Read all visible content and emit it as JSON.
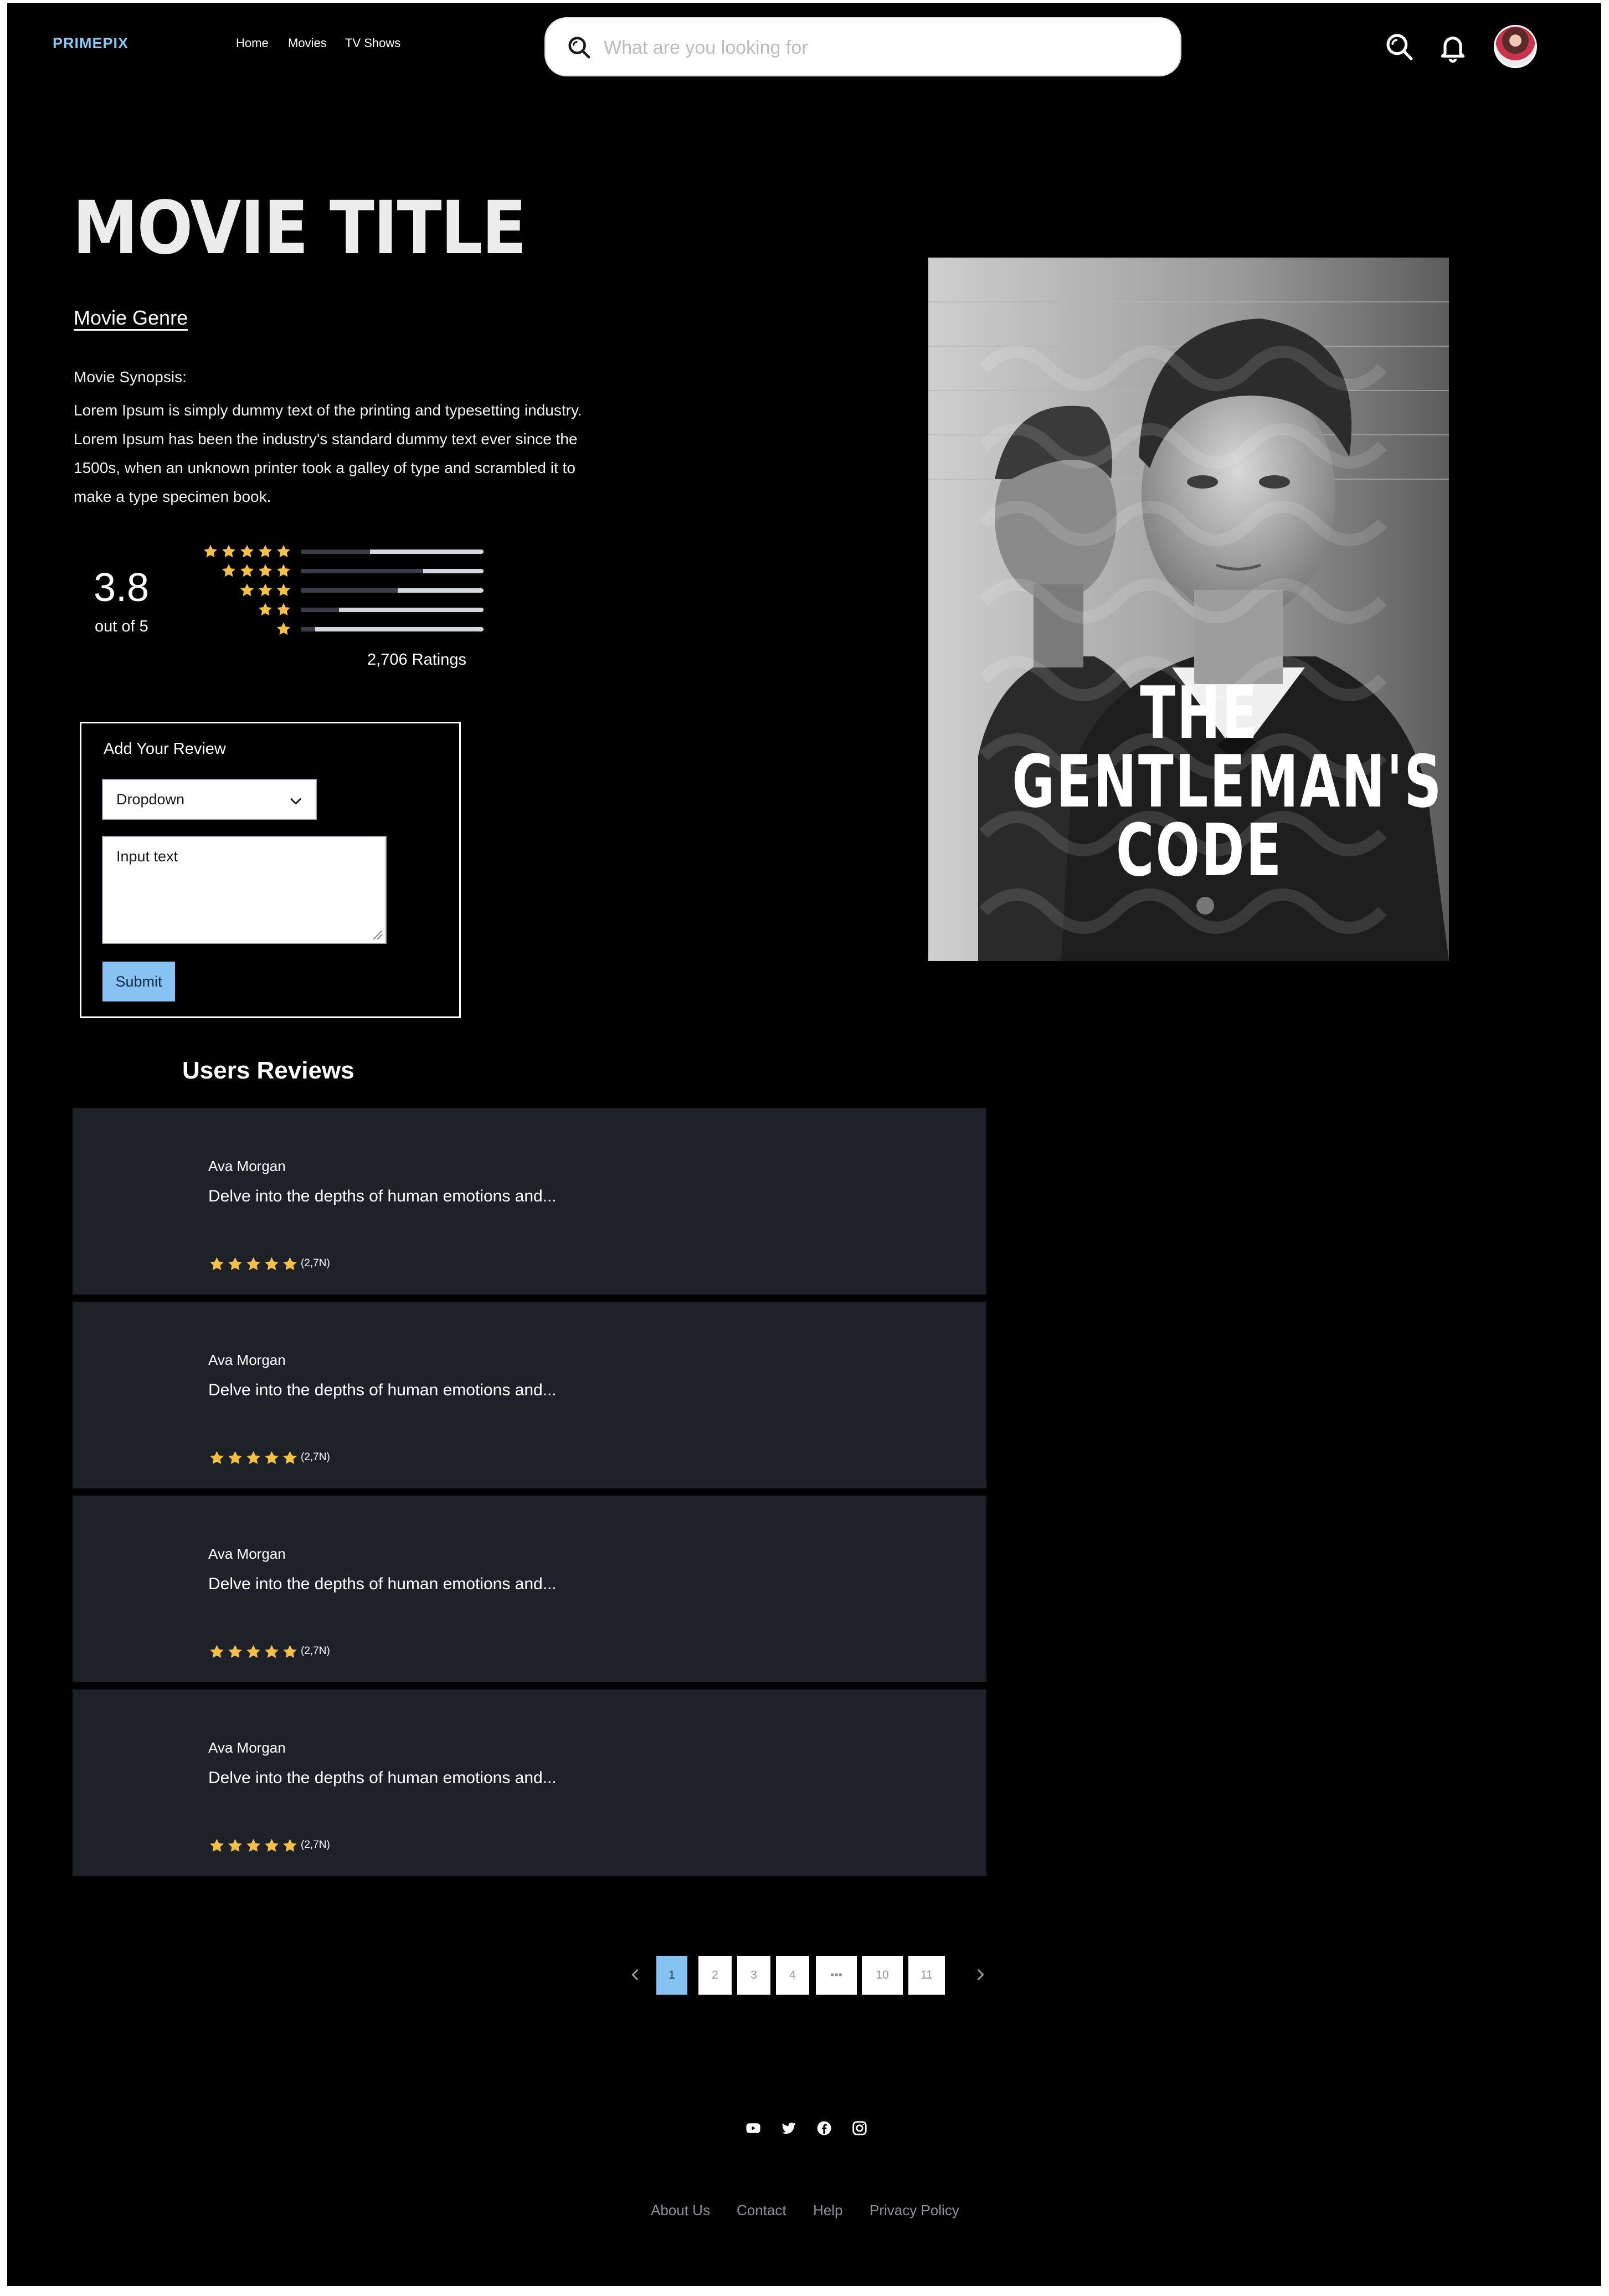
{
  "header": {
    "brand": "PRIMEPIX",
    "nav": [
      "Home",
      "Movies",
      "TV Shows"
    ],
    "search_placeholder": "What are you looking for"
  },
  "movie": {
    "title": "MOVIE TITLE",
    "genre": "Movie Genre",
    "synopsis_label": "Movie Synopsis:",
    "synopsis": "Lorem Ipsum is simply dummy text of the printing and typesetting industry. Lorem Ipsum has been the industry's standard dummy text ever since the 1500s, when an unknown printer took a galley of type and scrambled it to make a type specimen book.",
    "poster_title_line1": "THE GENTLEMAN'S",
    "poster_title_line2": "CODE"
  },
  "ratings": {
    "average": "3.8",
    "out_of": "out of 5",
    "total": "2,706 Ratings",
    "distribution": [
      {
        "stars": 5,
        "fraction": 0.38
      },
      {
        "stars": 4,
        "fraction": 0.67
      },
      {
        "stars": 3,
        "fraction": 0.53
      },
      {
        "stars": 2,
        "fraction": 0.21
      },
      {
        "stars": 1,
        "fraction": 0.08
      }
    ]
  },
  "review_form": {
    "title": "Add Your Review",
    "dropdown_value": "Dropdown",
    "input_text": "Input text",
    "submit_label": "Submit"
  },
  "reviews": {
    "heading": "Users Reviews",
    "items": [
      {
        "name": "Ava Morgan",
        "text": "Delve into the depths of human emotions and...",
        "stars": 5,
        "count": "(2,7N)"
      },
      {
        "name": "Ava Morgan",
        "text": "Delve into the depths of human emotions and...",
        "stars": 5,
        "count": "(2,7N)"
      },
      {
        "name": "Ava Morgan",
        "text": "Delve into the depths of human emotions and...",
        "stars": 5,
        "count": "(2,7N)"
      },
      {
        "name": "Ava Morgan",
        "text": "Delve into the depths of human emotions and...",
        "stars": 5,
        "count": "(2,7N)"
      }
    ]
  },
  "pagination": {
    "pages": [
      "1",
      "2",
      "3",
      "4",
      "•••",
      "10",
      "11"
    ],
    "current": "1"
  },
  "footer": {
    "social_icons": [
      "youtube-icon",
      "twitter-icon",
      "facebook-icon",
      "instagram-icon"
    ],
    "links": [
      "About Us",
      "Contact",
      "Help",
      "Privacy Policy"
    ]
  },
  "colors": {
    "accent": "#86c2f2",
    "star": "#f5c046",
    "card_bg": "#1f2128",
    "background": "#000000"
  }
}
